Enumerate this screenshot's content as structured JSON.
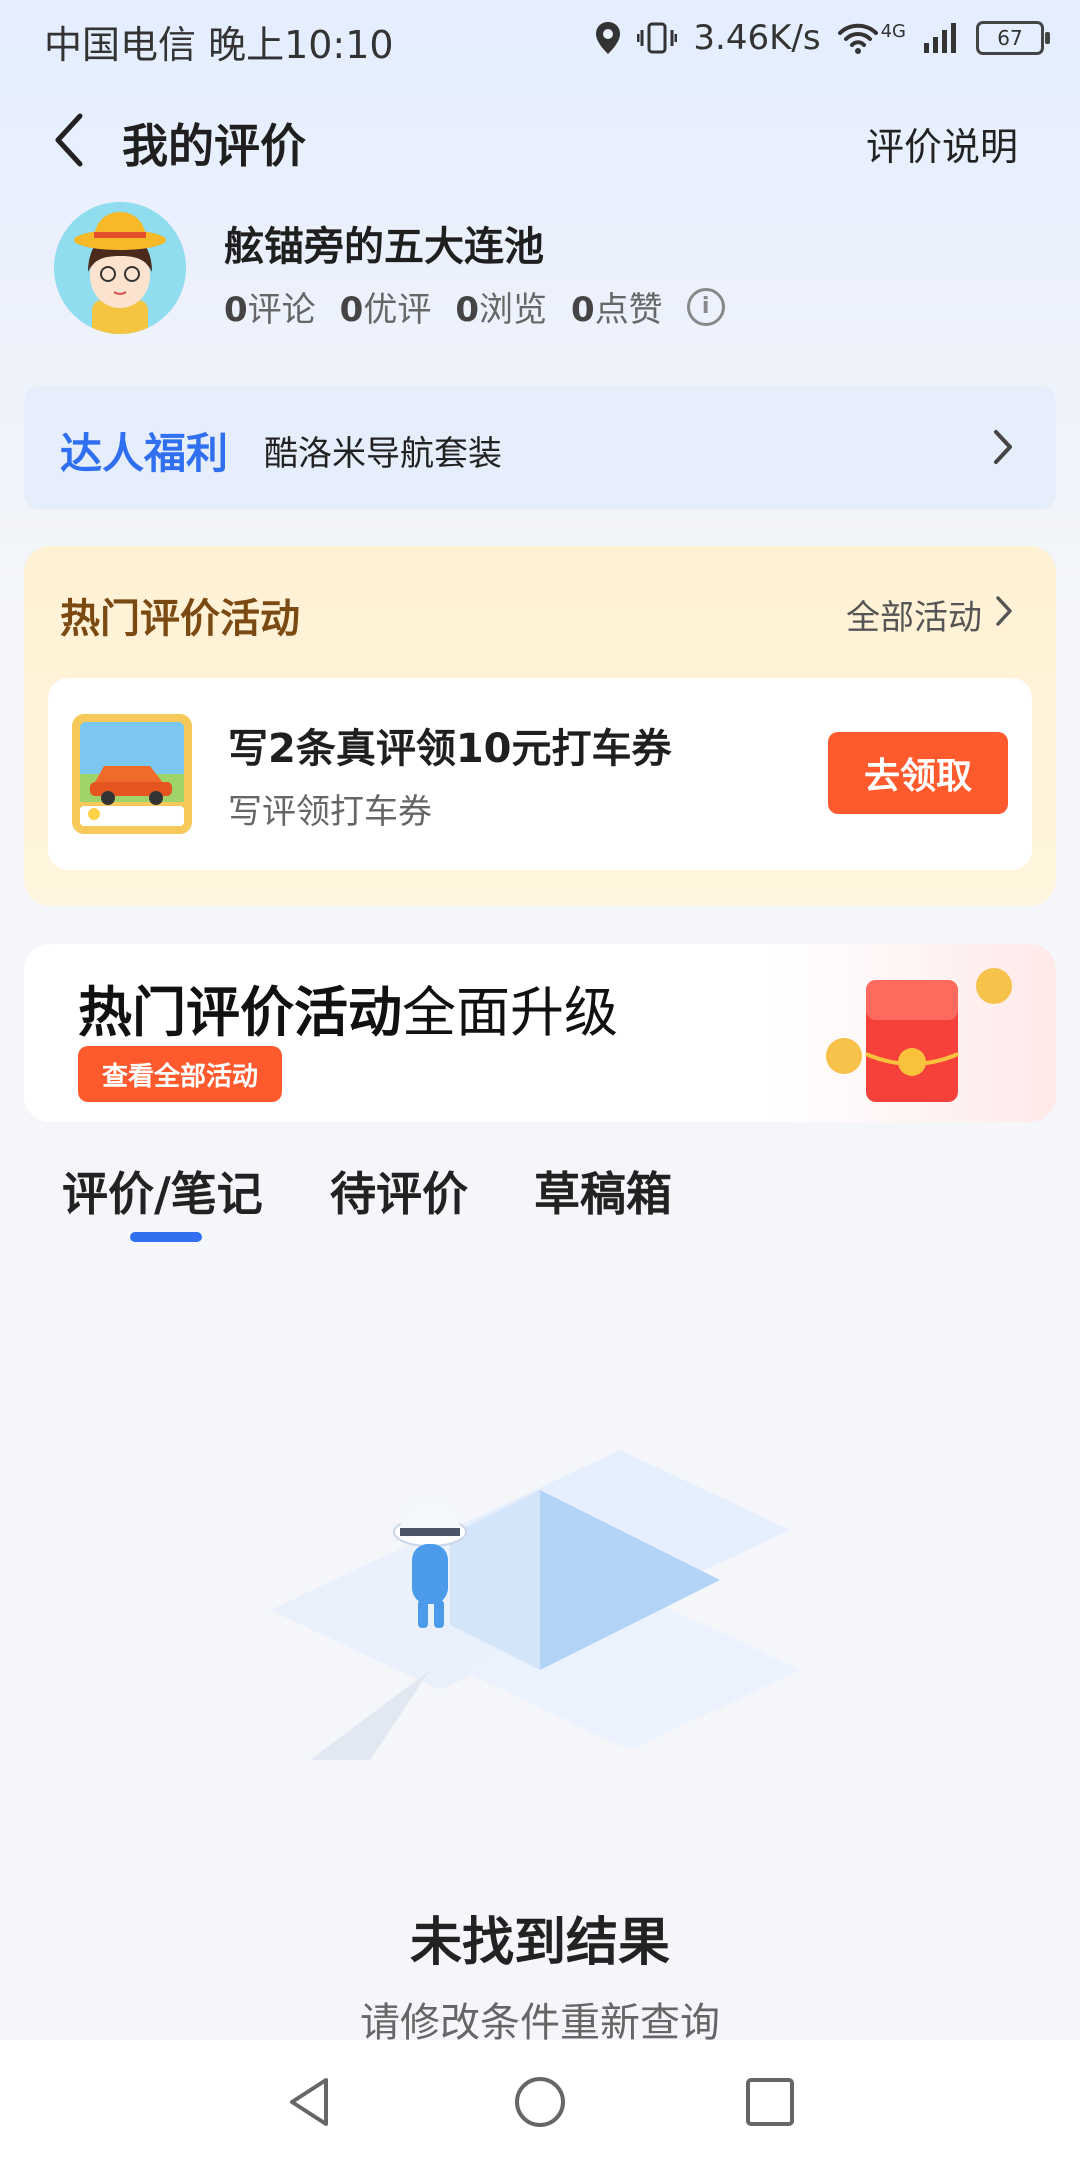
{
  "status_bar": {
    "carrier_time": "中国电信 晚上10:10",
    "speed": "3.46K/s",
    "network": "4G",
    "battery": "67"
  },
  "header": {
    "title": "我的评价",
    "help_link": "评价说明"
  },
  "profile": {
    "username": "舷锚旁的五大连池",
    "stats": [
      {
        "value": "0",
        "label": "评论"
      },
      {
        "value": "0",
        "label": "优评"
      },
      {
        "value": "0",
        "label": "浏览"
      },
      {
        "value": "0",
        "label": "点赞"
      }
    ]
  },
  "welfare": {
    "title": "达人福利",
    "text": "酷洛米导航套装"
  },
  "hot_activity": {
    "title": "热门评价活动",
    "all_link": "全部活动",
    "card": {
      "title": "写2条真评领10元打车券",
      "subtitle": "写评领打车券",
      "button": "去领取"
    }
  },
  "banner": {
    "title_bold": "热门评价活动",
    "title_normal": "全面升级",
    "button": "查看全部活动"
  },
  "tabs": [
    {
      "label": "评价/笔记",
      "active": true
    },
    {
      "label": "待评价",
      "active": false
    },
    {
      "label": "草稿箱",
      "active": false
    }
  ],
  "empty_state": {
    "title": "未找到结果",
    "subtitle": "请修改条件重新查询"
  },
  "colors": {
    "accent_blue": "#2F6FF0",
    "accent_orange": "#FF5A2E",
    "activity_title": "#7A4A12"
  }
}
